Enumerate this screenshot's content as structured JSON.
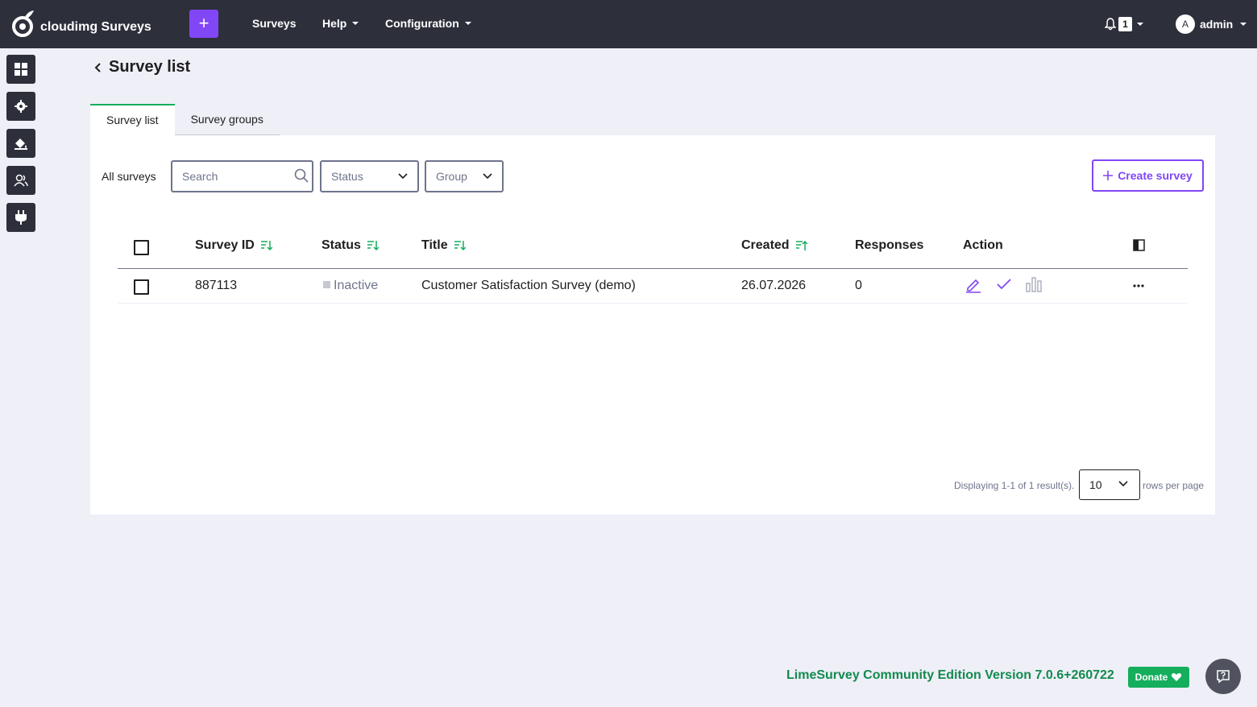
{
  "topbar": {
    "brand": "cloudimg Surveys",
    "plus_label": "+",
    "nav": [
      "Surveys",
      "Help",
      "Configuration"
    ],
    "notification_count": "1",
    "user_initial": "A",
    "user_name": "admin"
  },
  "sidebar": {
    "items": [
      "dashboard-icon",
      "settings-icon",
      "theme-icon",
      "users-icon",
      "plugins-icon"
    ]
  },
  "page": {
    "title": "Survey list"
  },
  "tabs": [
    {
      "label": "Survey list",
      "active": true
    },
    {
      "label": "Survey groups",
      "active": false
    }
  ],
  "filters": {
    "label": "All surveys",
    "search_placeholder": "Search",
    "status_placeholder": "Status",
    "group_placeholder": "Group",
    "create_label": "Create survey"
  },
  "table": {
    "headers": [
      "Survey ID",
      "Status",
      "Title",
      "Created",
      "Responses",
      "Action"
    ],
    "rows": [
      {
        "id": "887113",
        "status": "Inactive",
        "title": "Customer Satisfaction Survey (demo)",
        "created": "26.07.2026",
        "responses": "0"
      }
    ]
  },
  "pagination": {
    "summary": "Displaying 1-1 of 1 result(s).",
    "rows_per_page": "10",
    "rows_per_page_label": "rows per page"
  },
  "footer": {
    "version": "LimeSurvey Community Edition Version 7.0.6+260722",
    "donate_label": "Donate"
  },
  "colors": {
    "topbar": "#2d2f3b",
    "accent": "#8146f6",
    "green": "#14ae5c",
    "background": "#eeeff7"
  }
}
